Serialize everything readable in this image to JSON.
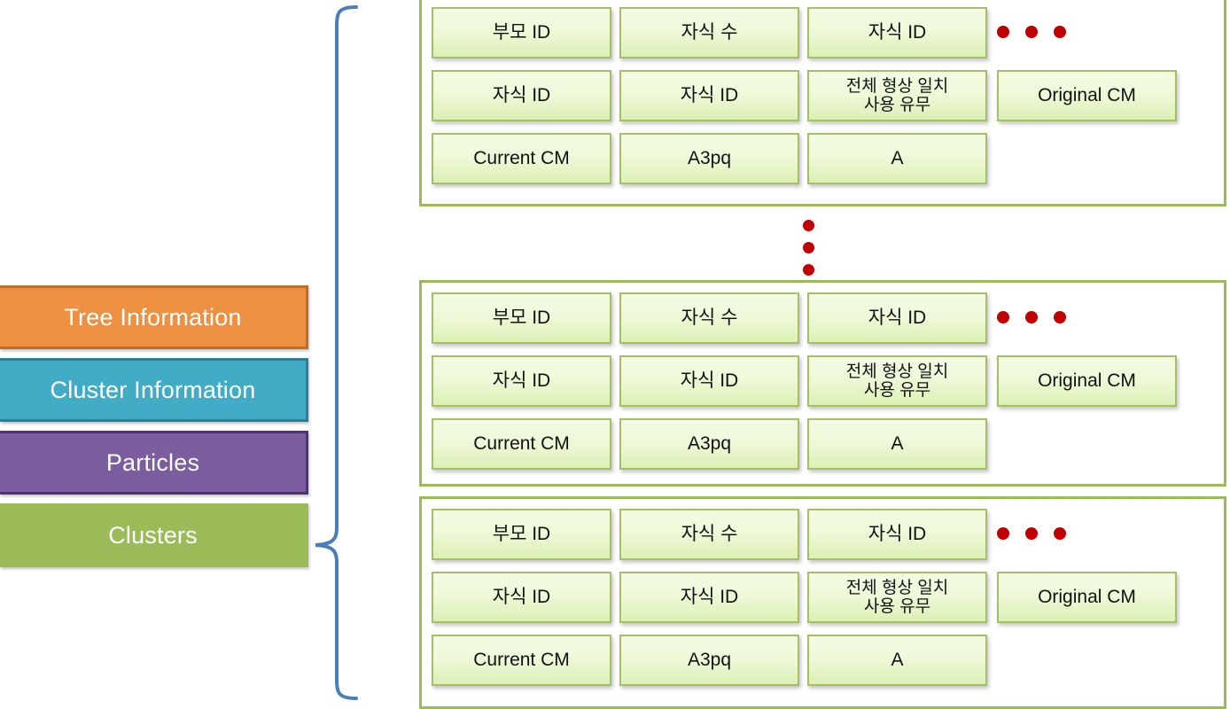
{
  "sidebar": {
    "items": [
      {
        "label": "Tree Information",
        "color": "#ED9042",
        "border": "#C06D26",
        "name": "tree-information"
      },
      {
        "label": "Cluster Information",
        "color": "#42ACC6",
        "border": "#2B7F96",
        "name": "cluster-information"
      },
      {
        "label": "Particles",
        "color": "#7C5DA0",
        "border": "#4B3470",
        "name": "particles"
      },
      {
        "label": "Clusters",
        "color": "#9BBB59",
        "border": "#9BBB59",
        "name": "clusters"
      }
    ]
  },
  "brace": {
    "color": "#4A7EBB",
    "name": "curly-brace-connector"
  },
  "ellipsis": {
    "horizontal_label": "• • •",
    "vertical_label": "•",
    "color": "#C00000"
  },
  "cluster_groups": [
    {
      "id": "cluster-record-1",
      "cells": [
        {
          "label": "부모 ID",
          "col": 1,
          "row": 1
        },
        {
          "label": "자식 수",
          "col": 2,
          "row": 1
        },
        {
          "label": "자식 ID",
          "col": 3,
          "row": 1
        },
        {
          "label": "자식 ID",
          "col": 1,
          "row": 2
        },
        {
          "label": "자식 ID",
          "col": 2,
          "row": 2
        },
        {
          "label": "전체 형상 일치\n사용 유무",
          "col": 3,
          "row": 2,
          "two_line": true
        },
        {
          "label": "Original CM",
          "col": 4,
          "row": 2
        },
        {
          "label": "Current CM",
          "col": 1,
          "row": 3
        },
        {
          "label": "A3pq",
          "col": 2,
          "row": 3
        },
        {
          "label": "A",
          "col": 3,
          "row": 3
        }
      ]
    },
    {
      "id": "cluster-record-2",
      "cells": [
        {
          "label": "부모 ID",
          "col": 1,
          "row": 1
        },
        {
          "label": "자식 수",
          "col": 2,
          "row": 1
        },
        {
          "label": "자식 ID",
          "col": 3,
          "row": 1
        },
        {
          "label": "자식 ID",
          "col": 1,
          "row": 2
        },
        {
          "label": "자식 ID",
          "col": 2,
          "row": 2
        },
        {
          "label": "전체 형상 일치\n사용 유무",
          "col": 3,
          "row": 2,
          "two_line": true
        },
        {
          "label": "Original CM",
          "col": 4,
          "row": 2
        },
        {
          "label": "Current CM",
          "col": 1,
          "row": 3
        },
        {
          "label": "A3pq",
          "col": 2,
          "row": 3
        },
        {
          "label": "A",
          "col": 3,
          "row": 3
        }
      ]
    },
    {
      "id": "cluster-record-3",
      "cells": [
        {
          "label": "부모 ID",
          "col": 1,
          "row": 1
        },
        {
          "label": "자식 수",
          "col": 2,
          "row": 1
        },
        {
          "label": "자식 ID",
          "col": 3,
          "row": 1
        },
        {
          "label": "자식 ID",
          "col": 1,
          "row": 2
        },
        {
          "label": "자식 ID",
          "col": 2,
          "row": 2
        },
        {
          "label": "전체 형상 일치\n사용 유무",
          "col": 3,
          "row": 2,
          "two_line": true
        },
        {
          "label": "Original CM",
          "col": 4,
          "row": 2
        },
        {
          "label": "Current CM",
          "col": 1,
          "row": 3
        },
        {
          "label": "A3pq",
          "col": 2,
          "row": 3
        },
        {
          "label": "A",
          "col": 3,
          "row": 3
        }
      ]
    }
  ],
  "colors": {
    "cell_border": "#A3C162",
    "cell_fill_top": "#F4FBE4",
    "cell_fill_bottom": "#DCF0B4",
    "group_border": "#9BBB59",
    "dot": "#C00000",
    "brace": "#4A7EBB"
  }
}
